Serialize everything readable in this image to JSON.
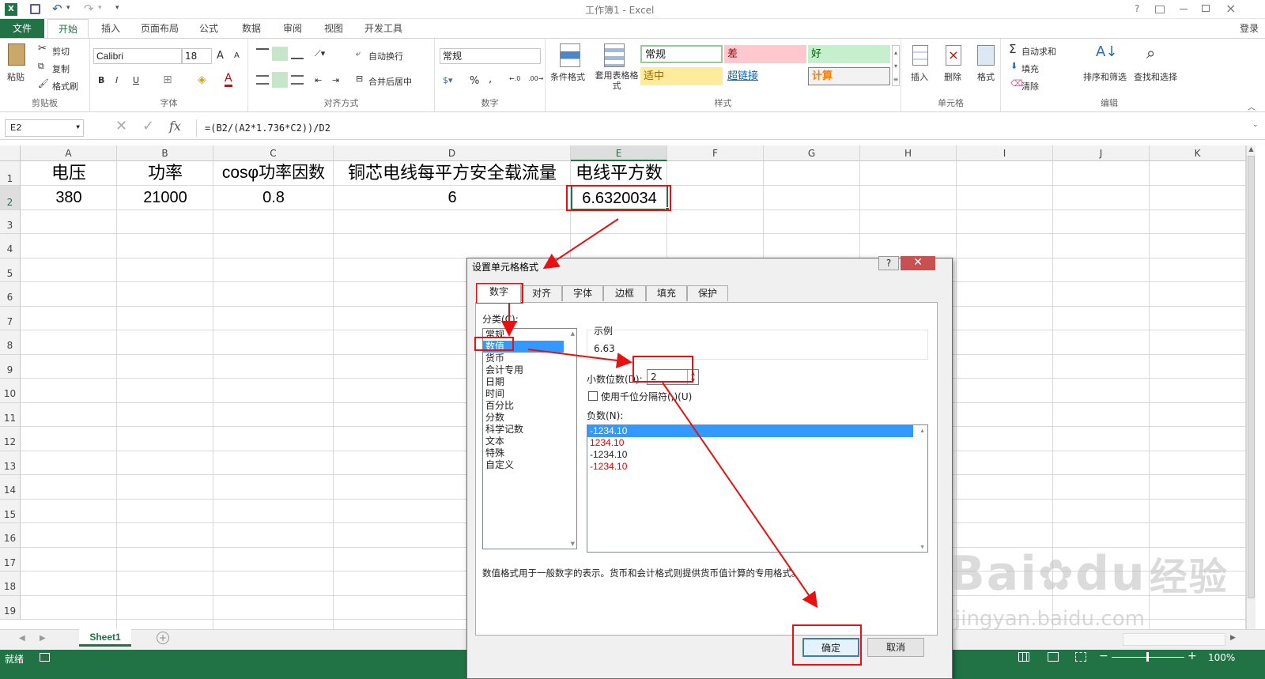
{
  "window": {
    "title": "工作簿1 - Excel",
    "login": "登录",
    "help": "?",
    "qat_more": "▾"
  },
  "ribbon_tabs": [
    "文件",
    "开始",
    "插入",
    "页面布局",
    "公式",
    "数据",
    "审阅",
    "视图",
    "开发工具"
  ],
  "clipboard": {
    "paste": "粘贴",
    "cut": "剪切",
    "copy": "复制",
    "format_painter": "格式刷",
    "label": "剪贴板"
  },
  "font": {
    "name": "Calibri",
    "size": "18",
    "bold": "B",
    "italic": "I",
    "underline": "U",
    "label": "字体",
    "grow": "A",
    "shrink": "A"
  },
  "alignment": {
    "wrap": "自动换行",
    "merge": "合并后居中",
    "label": "对齐方式"
  },
  "number": {
    "format": "常规",
    "label": "数字",
    "percent": "%",
    "comma": ","
  },
  "styles": {
    "conditional": "条件格式",
    "table": "套用表格格式",
    "cells": [
      "常规",
      "差",
      "好",
      "适中",
      "超链接",
      "计算"
    ],
    "label": "样式"
  },
  "cells_group": {
    "insert": "插入",
    "delete": "删除",
    "format": "格式",
    "label": "单元格"
  },
  "editing": {
    "autosum": "自动求和",
    "fill": "填充",
    "clear": "清除",
    "sort": "排序和筛选",
    "find": "查找和选择",
    "label": "编辑"
  },
  "formula_bar": {
    "name_box": "E2",
    "formula": "=(B2/(A2*1.736*C2))/D2",
    "fx": "fx"
  },
  "columns": [
    "A",
    "B",
    "C",
    "D",
    "E",
    "F",
    "G",
    "H",
    "I",
    "J",
    "K"
  ],
  "rows": [
    "1",
    "2",
    "3",
    "4",
    "5",
    "6",
    "7",
    "8",
    "9",
    "10",
    "11",
    "12",
    "13",
    "14",
    "15",
    "16",
    "17",
    "18",
    "19"
  ],
  "cells": {
    "A1": "电压",
    "B1": "功率",
    "C1": "cosφ功率因数",
    "D1": "铜芯电线每平方安全载流量",
    "E1": "电线平方数",
    "A2": "380",
    "B2": "21000",
    "C2": "0.8",
    "D2": "6",
    "E2": "6.6320034"
  },
  "sheet_tab": "Sheet1",
  "status": {
    "ready": "就绪",
    "zoom": "100%"
  },
  "dialog": {
    "title": "设置单元格格式",
    "tabs": [
      "数字",
      "对齐",
      "字体",
      "边框",
      "填充",
      "保护"
    ],
    "category_label": "分类(C):",
    "categories": [
      "常规",
      "数值",
      "货币",
      "会计专用",
      "日期",
      "时间",
      "百分比",
      "分数",
      "科学记数",
      "文本",
      "特殊",
      "自定义"
    ],
    "sample_label": "示例",
    "sample_value": "6.63",
    "decimal_label": "小数位数(D):",
    "decimal_value": "2",
    "thousands_label": "使用千位分隔符(,)(U)",
    "negative_label": "负数(N):",
    "negatives": [
      "-1234.10",
      "1234.10",
      "-1234.10",
      "-1234.10"
    ],
    "description": "数值格式用于一般数字的表示。货币和会计格式则提供货币值计算的专用格式。",
    "ok": "确定",
    "cancel": "取消"
  },
  "watermark": {
    "brand": "Bai",
    "brand2": "du",
    "brand3": "经验",
    "url": "jingyan.baidu.com"
  }
}
